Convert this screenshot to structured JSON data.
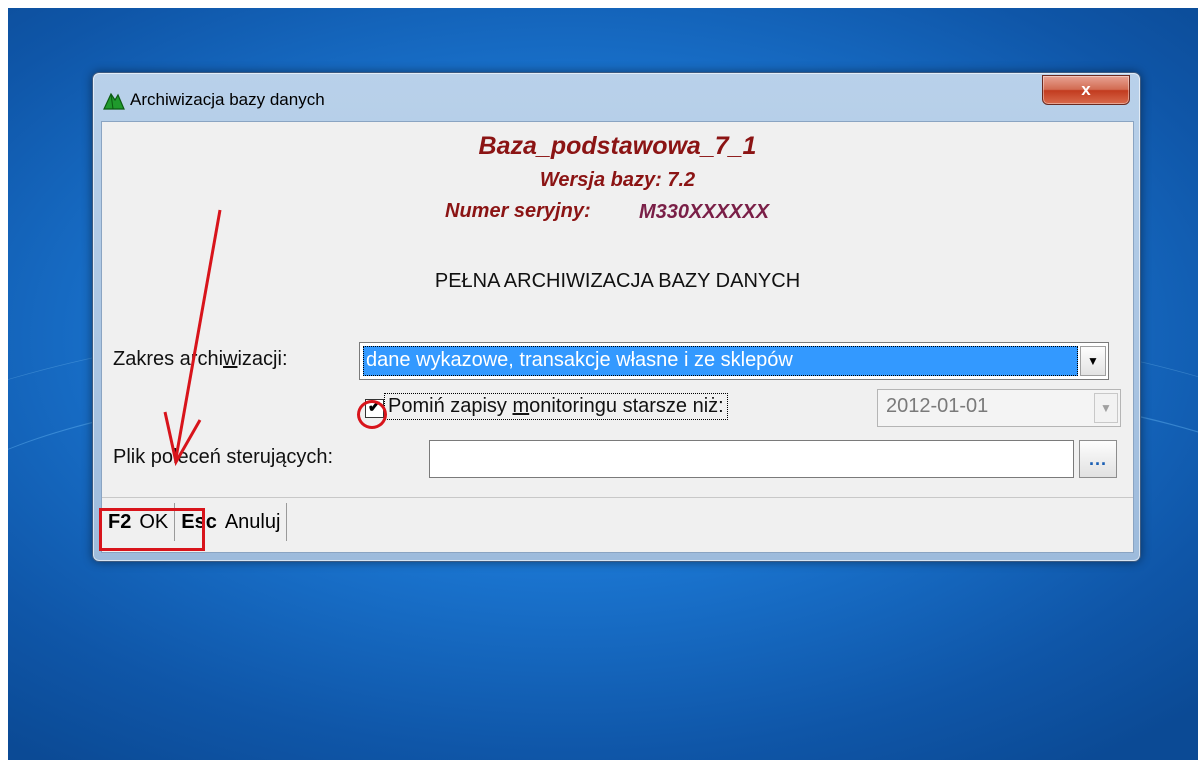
{
  "window": {
    "title": "Archiwizacja bazy danych",
    "close_label": "x"
  },
  "header": {
    "db_name": "Baza_podstawowa_7_1",
    "db_version": "Wersja bazy: 7.2",
    "serial_label": "Numer seryjny:",
    "serial_value": "M330XXXXXX"
  },
  "section_title": "PEŁNA ARCHIWIZACJA BAZY DANYCH",
  "scope": {
    "label_pre": "Zakres archi",
    "label_accel": "w",
    "label_post": "izacji:",
    "selected_value": "dane wykazowe, transakcje własne i ze sklepów"
  },
  "monitoring": {
    "checked": true,
    "check_mark": "✔",
    "label_pre": "Pomiń zapisy ",
    "label_accel": "m",
    "label_post": "onitoringu starsze niż:",
    "date_value": "2012-01-01"
  },
  "control_file": {
    "label": "Plik poleceń sterujących:",
    "value": "",
    "browse_label": "..."
  },
  "buttons": {
    "ok_key": "F2",
    "ok_label": "OK",
    "cancel_key": "Esc",
    "cancel_label": "Anuluj"
  },
  "colors": {
    "db_header": "#8b1414",
    "serial": "#7a1f47",
    "selection": "#3399ff",
    "annotation": "#d8141b"
  },
  "icons": {
    "app": "green-leaf-icon",
    "close": "close-icon",
    "dropdown": "chevron-down-icon"
  }
}
